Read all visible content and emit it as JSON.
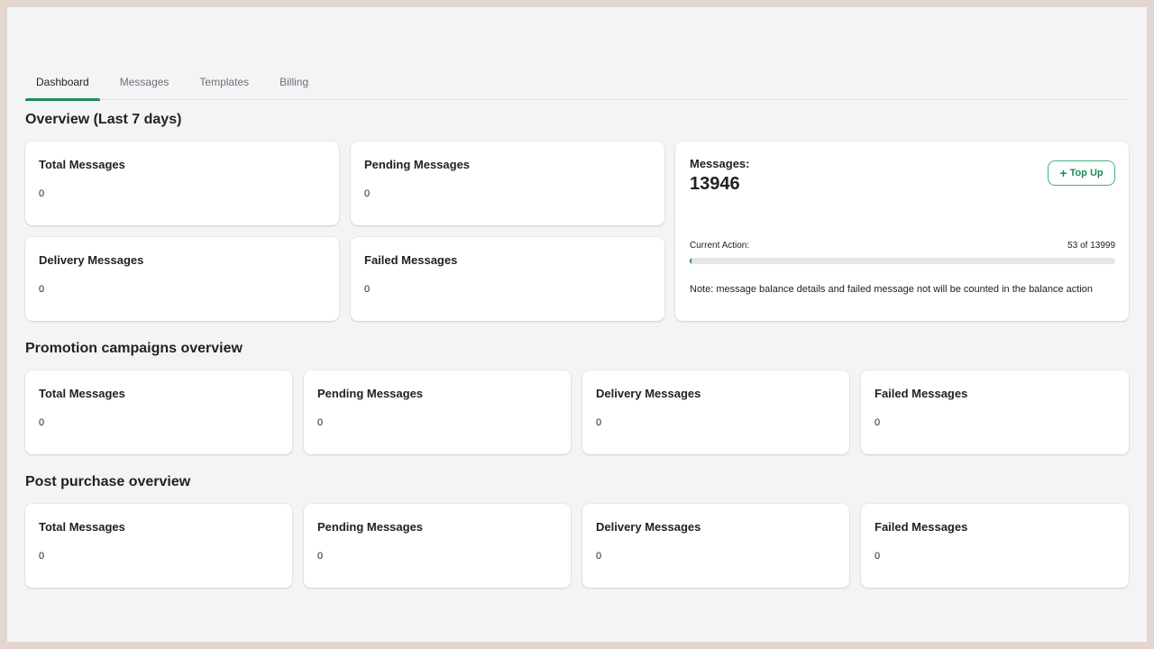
{
  "tabs": [
    {
      "label": "Dashboard",
      "active": true
    },
    {
      "label": "Messages",
      "active": false
    },
    {
      "label": "Templates",
      "active": false
    },
    {
      "label": "Billing",
      "active": false
    }
  ],
  "overview": {
    "title": "Overview (Last 7 days)",
    "cards": [
      {
        "label": "Total Messages",
        "value": "0"
      },
      {
        "label": "Pending Messages",
        "value": "0"
      },
      {
        "label": "Delivery Messages",
        "value": "0"
      },
      {
        "label": "Failed Messages",
        "value": "0"
      }
    ],
    "balance": {
      "label": "Messages:",
      "value": "13946",
      "topup_icon": "plus-icon",
      "topup_label": "Top Up",
      "current_action_label": "Current Action:",
      "current_action_count": "53 of 13999",
      "progress_fraction": 0.0038,
      "note": "Note: message balance details and failed message not will be counted in the balance action"
    }
  },
  "promotion": {
    "title": "Promotion campaigns overview",
    "cards": [
      {
        "label": "Total Messages",
        "value": "0"
      },
      {
        "label": "Pending Messages",
        "value": "0"
      },
      {
        "label": "Delivery Messages",
        "value": "0"
      },
      {
        "label": "Failed Messages",
        "value": "0"
      }
    ]
  },
  "post_purchase": {
    "title": "Post purchase overview",
    "cards": [
      {
        "label": "Total Messages",
        "value": "0"
      },
      {
        "label": "Pending Messages",
        "value": "0"
      },
      {
        "label": "Delivery Messages",
        "value": "0"
      },
      {
        "label": "Failed Messages",
        "value": "0"
      }
    ]
  },
  "colors": {
    "accent": "#1f8a5b",
    "frame_border": "#e3d6ce",
    "background": "#f4f4f6"
  }
}
